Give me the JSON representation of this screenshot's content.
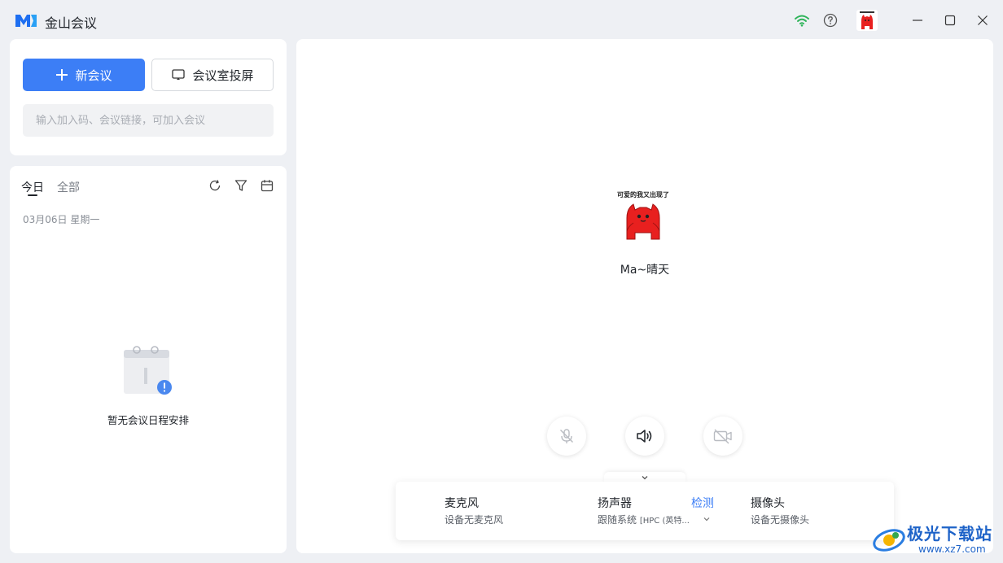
{
  "app": {
    "title": "金山会议",
    "avatar_caption": "可爱的我又出现了"
  },
  "toolbar": {
    "new_meeting_label": "新会议",
    "cast_label": "会议室投屏",
    "join_placeholder": "输入加入码、会议链接，可加入会议"
  },
  "schedule": {
    "tabs": [
      {
        "label": "今日",
        "active": true
      },
      {
        "label": "全部",
        "active": false
      }
    ],
    "date": "03月06日 星期一",
    "empty_text": "暂无会议日程安排"
  },
  "main": {
    "user_name": "Ma~晴天"
  },
  "devices": {
    "mic": {
      "title": "麦克风",
      "status": "设备无麦克风"
    },
    "speaker": {
      "title": "扬声器",
      "detect_label": "检测",
      "status_main": "跟随系统",
      "status_detail": "[HPC (英特..."
    },
    "camera": {
      "title": "摄像头",
      "status": "设备无摄像头"
    }
  },
  "watermark": {
    "text": "极光下载站",
    "url": "www.xz7.com"
  },
  "colors": {
    "accent": "#3c7ef6",
    "wifi": "#2fb45a",
    "avatar_red": "#e8201f",
    "background": "#eef0f4"
  }
}
